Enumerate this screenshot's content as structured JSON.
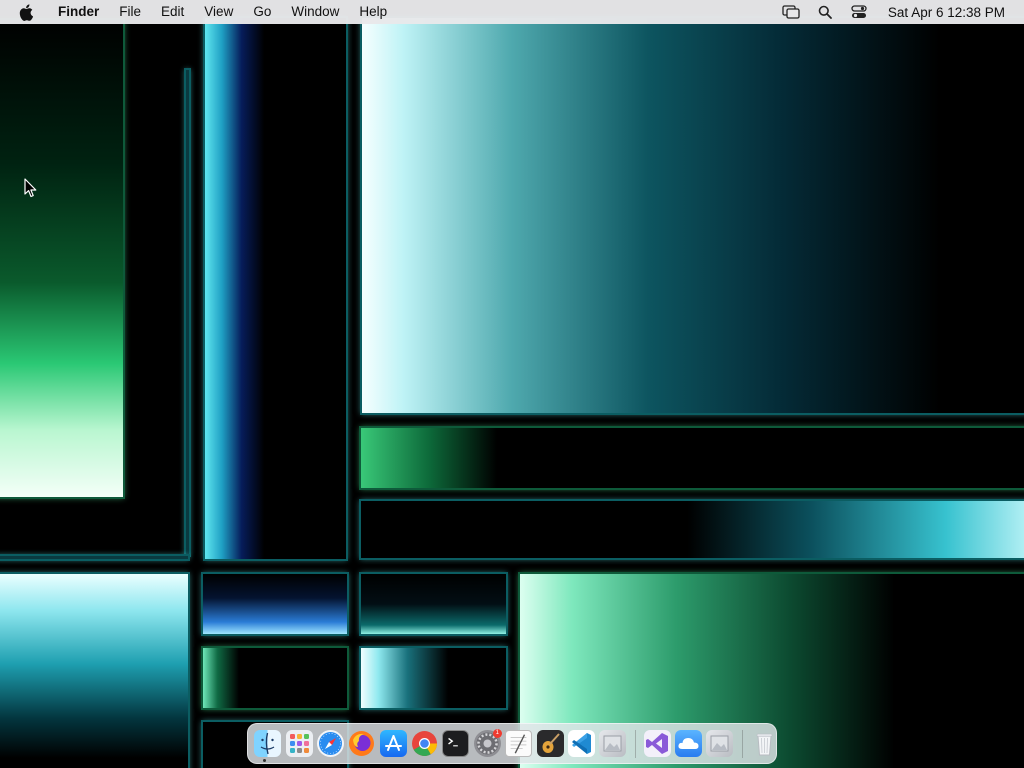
{
  "menubar": {
    "apple_icon": "apple-logo-icon",
    "app_name": "Finder",
    "menus": [
      "File",
      "Edit",
      "View",
      "Go",
      "Window",
      "Help"
    ],
    "status_icons": [
      "screen-mirroring-icon",
      "search-icon",
      "control-center-icon"
    ],
    "clock": "Sat Apr 6  12:38 PM"
  },
  "dock": {
    "apps": [
      {
        "name": "Finder",
        "icon": "finder-icon",
        "running": true
      },
      {
        "name": "Launchpad",
        "icon": "launchpad-icon"
      },
      {
        "name": "Safari",
        "icon": "safari-icon"
      },
      {
        "name": "Firefox",
        "icon": "firefox-icon"
      },
      {
        "name": "App Store",
        "icon": "app-store-icon"
      },
      {
        "name": "Google Chrome",
        "icon": "chrome-icon"
      },
      {
        "name": "Terminal",
        "icon": "terminal-icon"
      },
      {
        "name": "System Settings",
        "icon": "settings-gear-icon",
        "badge": "1"
      },
      {
        "name": "TextEdit",
        "icon": "textedit-icon"
      },
      {
        "name": "GarageBand",
        "icon": "guitar-icon"
      },
      {
        "name": "Visual Studio Code",
        "icon": "vscode-icon"
      },
      {
        "name": "Preview",
        "icon": "preview-icon"
      }
    ],
    "recents": [
      {
        "name": "Visual Studio",
        "icon": "visual-studio-icon"
      },
      {
        "name": "iCloud",
        "icon": "cloud-icon"
      },
      {
        "name": "Preview",
        "icon": "preview-icon"
      }
    ],
    "trash": {
      "name": "Trash",
      "icon": "trash-icon"
    }
  },
  "colors": {
    "menubar_bg": "#e8e8ea",
    "wallpaper_cyan": "#35c6d6",
    "wallpaper_green": "#2fd07e",
    "dock_bg": "#e1e4e8"
  }
}
